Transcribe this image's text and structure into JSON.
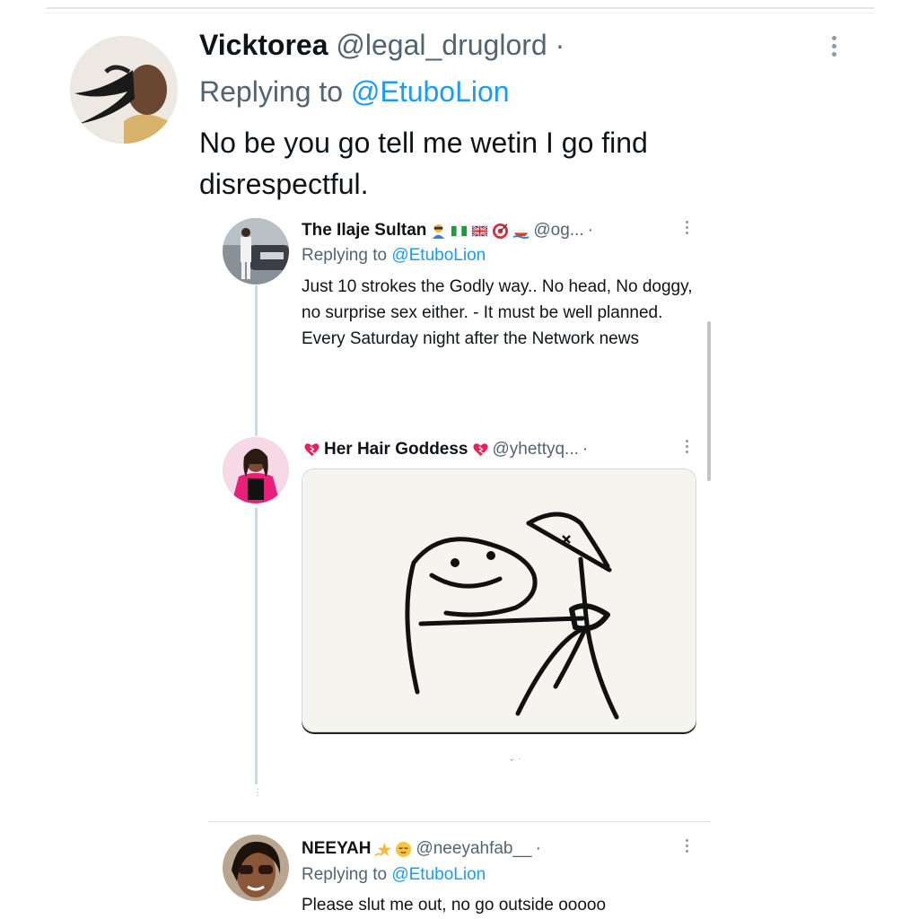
{
  "main": {
    "name": "Vicktorea",
    "handle": "@legal_druglord",
    "separator": "·",
    "reply_prefix": "Replying to",
    "reply_to": "@EtuboLion",
    "text": "No be you go tell me wetin I go find disrespectful."
  },
  "thread": [
    {
      "name": "The Ilaje Sultan",
      "handle": "@og...",
      "separator": "·",
      "reply_prefix": "Replying to",
      "reply_to": "@EtuboLion",
      "text": "Just 10 strokes the Godly way.. No head, No doggy, no surprise sex either. - It must be well planned. Every Saturday night after the Network news"
    },
    {
      "name": "Her Hair Goddess",
      "handle": "@yhettyq...",
      "separator": "·"
    },
    {
      "name": "NEEYAH",
      "handle": "@neeyahfab__",
      "separator": "·",
      "reply_prefix": "Replying to",
      "reply_to": "@EtuboLion",
      "text": "Please slut me out, no go outside ooooo"
    }
  ],
  "colors": {
    "link": "#1d9bf0",
    "secondary_text": "#536471",
    "primary_text": "#0f1419",
    "thread_line": "#cfd9de"
  },
  "icons": [
    "more-options-icon",
    "heart-icon",
    "flag-icon",
    "emoji-icon"
  ]
}
